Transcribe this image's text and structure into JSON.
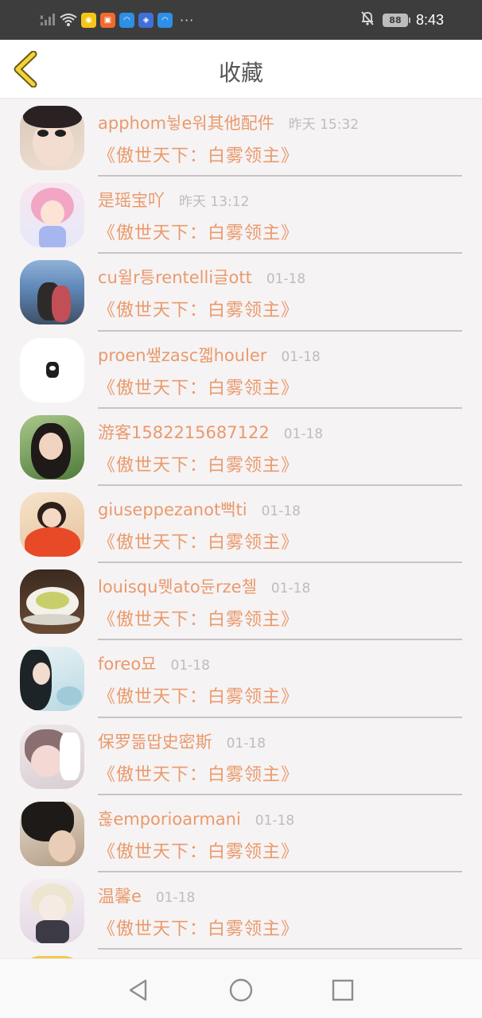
{
  "status_bar": {
    "time": "8:43",
    "battery": "88",
    "colors": {
      "background": "#3d3d3d",
      "text": "#ffffff"
    },
    "icons": [
      "signal-icon",
      "wifi-icon",
      "app-icon-1",
      "app-icon-2",
      "app-icon-3",
      "app-icon-4",
      "app-icon-5",
      "more-dots-icon",
      "bell-off-icon",
      "battery-icon"
    ]
  },
  "header": {
    "title": "收藏",
    "back_icon": "chevron-left-icon"
  },
  "colors": {
    "accent": "#e99a6c",
    "muted": "#c0bcbd",
    "background": "#f6f3f4"
  },
  "favorites": [
    {
      "name": "apphom뉳e워其他配件",
      "time": "昨天 15:32",
      "book": "《傲世天下：白雾领主》"
    },
    {
      "name": "是瑶宝吖",
      "time": "昨天 13:12",
      "book": "《傲世天下：白雾领主》"
    },
    {
      "name": "cu윌r틍rentelli글ott",
      "time": "01-18",
      "book": "《傲世天下：白雾领主》"
    },
    {
      "name": "proen쌮zasc꼛houler",
      "time": "01-18",
      "book": "《傲世天下：白雾领主》"
    },
    {
      "name": "游客1582215687122",
      "time": "01-18",
      "book": "《傲世天下：白雾领主》"
    },
    {
      "name": "giuseppezanot뻑ti",
      "time": "01-18",
      "book": "《傲世天下：白雾领主》"
    },
    {
      "name": "louisqu뭿ato듄rze첼",
      "time": "01-18",
      "book": "《傲世天下：白雾领主》"
    },
    {
      "name": "foreo묘",
      "time": "01-18",
      "book": "《傲世天下：白雾领主》"
    },
    {
      "name": "保罗뜲땁史密斯",
      "time": "01-18",
      "book": "《傲世天下：白雾领主》"
    },
    {
      "name": "훊emporioarmani",
      "time": "01-18",
      "book": "《傲世天下：白雾领主》"
    },
    {
      "name": "温馨e",
      "time": "01-18",
      "book": "《傲世天下：白雾领主》"
    }
  ],
  "nav_bar": {
    "icons": [
      "back-triangle-icon",
      "home-circle-icon",
      "recents-square-icon"
    ]
  }
}
